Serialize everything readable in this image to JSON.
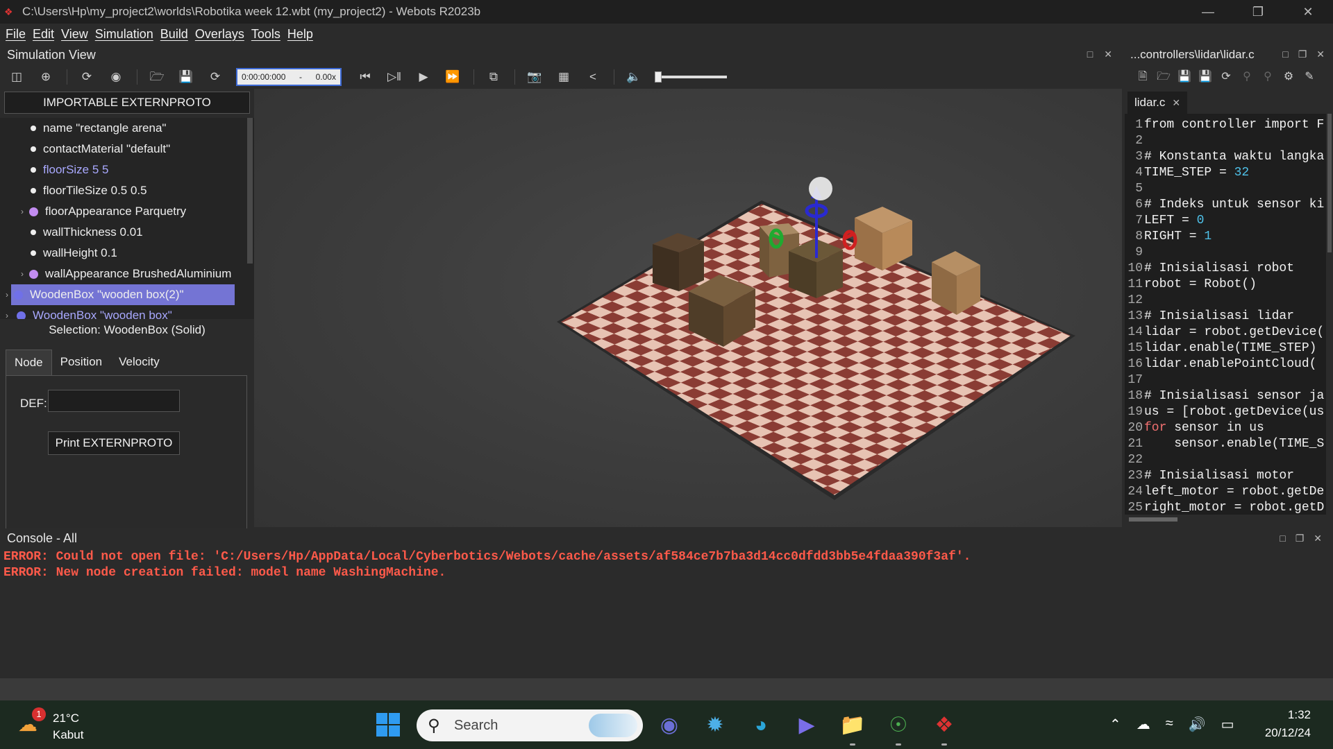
{
  "window": {
    "title": "C:\\Users\\Hp\\my_project2\\worlds\\Robotika week 12.wbt (my_project2) - Webots R2023b",
    "controls": [
      "minimize-icon",
      "restore-icon",
      "close-icon"
    ]
  },
  "menu": [
    "File",
    "Edit",
    "View",
    "Simulation",
    "Build",
    "Overlays",
    "Tools",
    "Help"
  ],
  "simulation_view": {
    "title": "Simulation View",
    "time": "0:00:00:000",
    "speed_prefix": "-",
    "speed": "0.00x",
    "sound_volume_fraction": 0.0
  },
  "left_panel": {
    "externproto_button": "IMPORTABLE EXTERNPROTO",
    "tree": [
      {
        "label": "name \"rectangle arena\"",
        "kind": "field"
      },
      {
        "label": "contactMaterial \"default\"",
        "kind": "field"
      },
      {
        "label": "floorSize 5 5",
        "kind": "field-modified"
      },
      {
        "label": "floorTileSize 0.5 0.5",
        "kind": "field"
      },
      {
        "label": "floorAppearance Parquetry",
        "kind": "node"
      },
      {
        "label": "wallThickness 0.01",
        "kind": "field"
      },
      {
        "label": "wallHeight 0.1",
        "kind": "field"
      },
      {
        "label": "wallAppearance BrushedAluminium",
        "kind": "node"
      },
      {
        "label": "WoodenBox \"wooden box(2)\"",
        "kind": "selected"
      },
      {
        "label": "WoodenBox \"wooden box\"",
        "kind": "top"
      }
    ],
    "selection": "Selection: WoodenBox (Solid)",
    "tabs": [
      "Node",
      "Position",
      "Velocity"
    ],
    "def_label": "DEF:",
    "def_value": "",
    "print_button": "Print EXTERNPROTO"
  },
  "editor": {
    "path": "...controllers\\lidar\\lidar.c",
    "tab": "lidar.c",
    "lines": [
      [
        "1",
        "from controller import F"
      ],
      [
        "2",
        ""
      ],
      [
        "3",
        "# Konstanta waktu langka"
      ],
      [
        "4",
        "TIME_STEP = ",
        "32"
      ],
      [
        "5",
        ""
      ],
      [
        "6",
        "# Indeks untuk sensor ki"
      ],
      [
        "7",
        "LEFT = ",
        "0"
      ],
      [
        "8",
        "RIGHT = ",
        "1"
      ],
      [
        "9",
        ""
      ],
      [
        "10",
        "# Inisialisasi robot"
      ],
      [
        "11",
        "robot = Robot()"
      ],
      [
        "12",
        ""
      ],
      [
        "13",
        "# Inisialisasi lidar"
      ],
      [
        "14",
        "lidar = robot.getDevice("
      ],
      [
        "15",
        "lidar.enable(TIME_STEP)"
      ],
      [
        "16",
        "lidar.enablePointCloud("
      ],
      [
        "17",
        ""
      ],
      [
        "18",
        "# Inisialisasi sensor ja"
      ],
      [
        "19",
        "us = [robot.getDevice(us"
      ],
      [
        "20",
        "for",
        " sensor in us"
      ],
      [
        "21",
        "    sensor.enable(TIME_S"
      ],
      [
        "22",
        ""
      ],
      [
        "23",
        "# Inisialisasi motor"
      ],
      [
        "24",
        "left_motor = robot.getDe"
      ],
      [
        "25",
        "right_motor = robot.getD"
      ]
    ]
  },
  "console": {
    "title": "Console - All",
    "errors": [
      "ERROR: Could not open file: 'C:/Users/Hp/AppData/Local/Cyberbotics/Webots/cache/assets/af584ce7b7ba3d14cc0dfdd3bb5e4fdaa390f3af'.",
      "ERROR: New node creation failed: model name WashingMachine."
    ],
    "error_color": "#ff5a4a"
  },
  "taskbar": {
    "weather_badge": "1",
    "temperature": "21°C",
    "weather": "Kabut",
    "search_placeholder": "Search",
    "time": "1:32",
    "date": "20/12/24"
  },
  "colors": {
    "selection": "#7474d4",
    "accent": "#3d6ad6",
    "field_modified": "#a9a9ff",
    "node_dot": "#c28cf0"
  }
}
